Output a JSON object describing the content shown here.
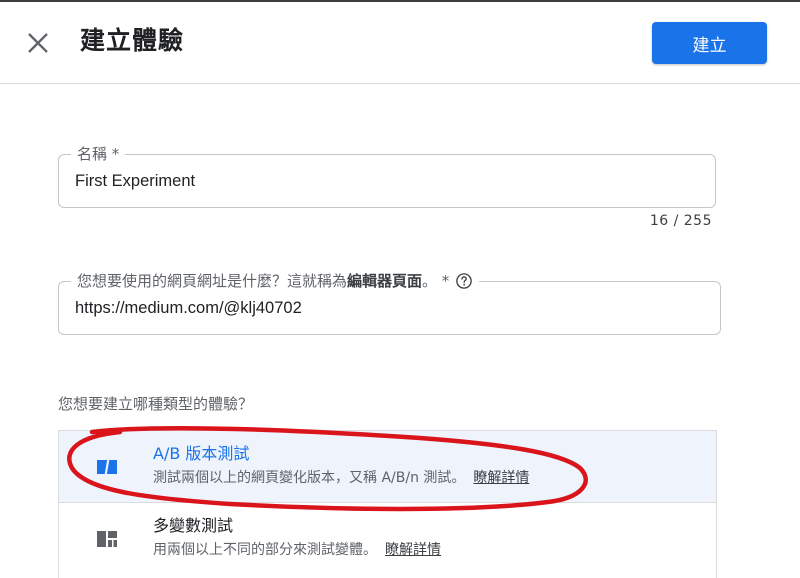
{
  "header": {
    "title": "建立體驗",
    "create_label": "建立",
    "close_icon": "close-icon"
  },
  "name_field": {
    "label": "名稱 *",
    "value": "First Experiment",
    "counter": "16 / 255"
  },
  "url_field": {
    "label_prefix": "您想要使用的網頁網址是什麼？這就稱為",
    "label_strong": "編輯器頁面",
    "label_suffix": "。 *",
    "help_icon": "help-circle-icon",
    "value": "https://medium.com/@klj40702"
  },
  "experience_type": {
    "question": "您想要建立哪種類型的體驗？",
    "options": [
      {
        "icon": "ab-test-icon",
        "title": "A/B 版本測試",
        "description": "測試兩個以上的網頁變化版本，又稱 A/B/n 測試。",
        "learn_more": "瞭解詳情",
        "selected": true
      },
      {
        "icon": "multivariate-grid-icon",
        "title": "多變數測試",
        "description": "用兩個以上不同的部分來測試變體。",
        "learn_more": "瞭解詳情",
        "selected": false
      }
    ]
  },
  "colors": {
    "primary": "#1a73e8",
    "selected_bg": "#eef3fc",
    "annotation": "#d9141b"
  }
}
